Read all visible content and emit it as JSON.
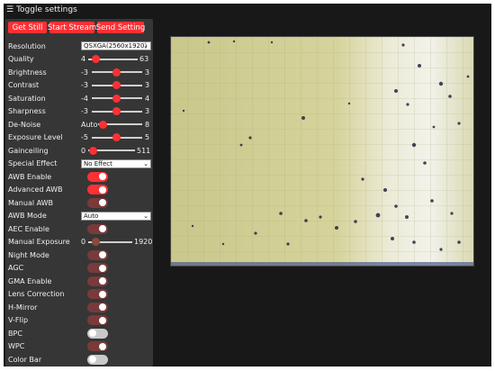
{
  "header": {
    "title": "Toggle settings"
  },
  "actions": {
    "get_still": "Get Still",
    "start_stream": "Start Stream",
    "send_setting": "Send Setting"
  },
  "settings": {
    "resolution": {
      "label": "Resolution",
      "value": "QSXGA(2560x1920)"
    },
    "quality": {
      "label": "Quality",
      "min": "4",
      "max": "63",
      "value": 10
    },
    "brightness": {
      "label": "Brightness",
      "min": "-3",
      "max": "3",
      "value": 0
    },
    "contrast": {
      "label": "Contrast",
      "min": "-3",
      "max": "3",
      "value": 0
    },
    "saturation": {
      "label": "Saturation",
      "min": "-4",
      "max": "4",
      "value": 0
    },
    "sharpness": {
      "label": "Sharpness",
      "min": "-3",
      "max": "3",
      "value": 0
    },
    "denoise": {
      "label": "De-Noise",
      "min": "Auto",
      "max": "8",
      "value": 0
    },
    "exposure_level": {
      "label": "Exposure Level",
      "min": "-5",
      "max": "5",
      "value": 0
    },
    "gainceiling": {
      "label": "Gainceiling",
      "min": "0",
      "max": "511",
      "value": 0
    },
    "special_effect": {
      "label": "Special Effect",
      "value": "No Effect"
    },
    "awb_enable": {
      "label": "AWB Enable",
      "state": "on"
    },
    "advanced_awb": {
      "label": "Advanced AWB",
      "state": "on"
    },
    "manual_awb": {
      "label": "Manual AWB",
      "state": "dim"
    },
    "awb_mode": {
      "label": "AWB Mode",
      "value": "Auto"
    },
    "aec_enable": {
      "label": "AEC Enable",
      "state": "dim"
    },
    "manual_exposure": {
      "label": "Manual Exposure",
      "min": "0",
      "max": "1920",
      "value": 0
    },
    "night_mode": {
      "label": "Night Mode",
      "state": "dim"
    },
    "agc": {
      "label": "AGC",
      "state": "dim"
    },
    "gma_enable": {
      "label": "GMA Enable",
      "state": "dim"
    },
    "lens_correction": {
      "label": "Lens Correction",
      "state": "dim"
    },
    "h_mirror": {
      "label": "H-Mirror",
      "state": "dim"
    },
    "v_flip": {
      "label": "V-Flip",
      "state": "dim"
    },
    "bpc": {
      "label": "BPC",
      "state": "off"
    },
    "wpc": {
      "label": "WPC",
      "state": "on"
    },
    "color_bar": {
      "label": "Color Bar",
      "state": "off"
    }
  },
  "colors": {
    "accent": "#ff3034",
    "panel": "#363636",
    "background": "#181818"
  },
  "icons": {
    "menu": "hamburger-icon",
    "dropdown": "chevron-down-icon"
  }
}
